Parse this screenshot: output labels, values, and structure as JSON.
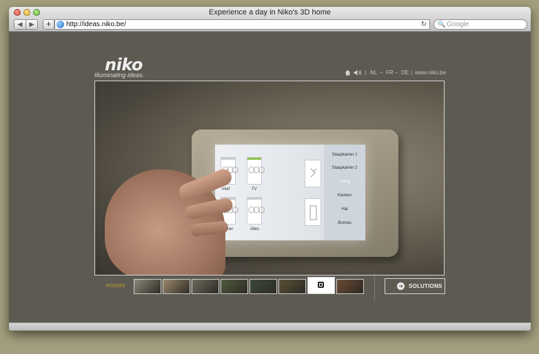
{
  "window": {
    "title": "Experience a day in Niko's 3D home"
  },
  "toolbar": {
    "back_glyph": "◀",
    "forward_glyph": "▶",
    "add_glyph": "+",
    "url": "http://ideas.niko.be/",
    "reload_glyph": "↻",
    "search_placeholder": "Google",
    "search_glyph": "🔍"
  },
  "header": {
    "logo": "niko",
    "tagline": "Illuminating ideas.",
    "languages": [
      "NL",
      "FR",
      "DE"
    ],
    "site_link": "www.niko.be",
    "separator": "–",
    "divider": "|"
  },
  "scene": {
    "tiles": [
      {
        "label": "mief",
        "bar": "off"
      },
      {
        "label": "TV",
        "bar": "on"
      },
      {
        "label": "tkamer",
        "bar": "off"
      },
      {
        "label": "Alles",
        "bar": "off"
      }
    ],
    "bulbs": "◯◯◯",
    "rooms": [
      {
        "label": "Slaapkamer 1",
        "active": false
      },
      {
        "label": "Slaapkamer 2",
        "active": false
      },
      {
        "label": "Living",
        "active": true
      },
      {
        "label": "Keuken",
        "active": false
      },
      {
        "label": "Hal",
        "active": false
      },
      {
        "label": "Bureau",
        "active": false
      }
    ]
  },
  "bottom_nav": {
    "rooms_label": "ROOMS",
    "thumbnail_colors": [
      "#8b8778",
      "#9a8a6c",
      "#6e695c",
      "#4f5a3e",
      "#3c4a3a",
      "#5a5138",
      "#ffffff",
      "#6b4a32"
    ],
    "solutions_label": "SOLUTIONS",
    "arrow_glyph": "➜"
  },
  "colors": {
    "accent_gold": "#c8a631",
    "on_green": "#8fc24a"
  }
}
